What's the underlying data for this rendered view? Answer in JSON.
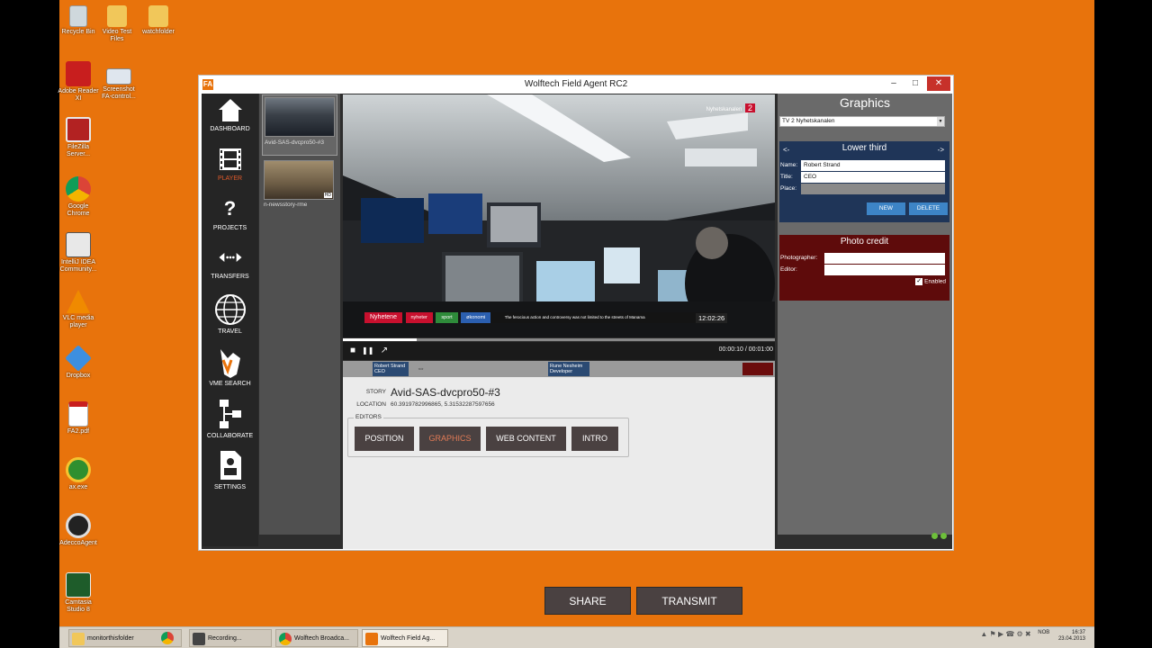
{
  "desktop": {
    "icons": [
      {
        "label": "Recycle Bin",
        "icon": "recycle-bin-icon"
      },
      {
        "label": "Video Test Files",
        "icon": "folder-icon"
      },
      {
        "label": "watchfolder",
        "icon": "folder-icon"
      },
      {
        "label": "Adobe Reader XI",
        "icon": "adobe-reader-icon"
      },
      {
        "label": "Screenshot FA-control...",
        "icon": "image-file-icon"
      },
      {
        "label": "FileZilla Server...",
        "icon": "filezilla-icon"
      },
      {
        "label": "Google Chrome",
        "icon": "chrome-icon"
      },
      {
        "label": "IntelliJ IDEA Community...",
        "icon": "intellij-icon"
      },
      {
        "label": "VLC media player",
        "icon": "vlc-icon"
      },
      {
        "label": "Dropbox",
        "icon": "dropbox-icon"
      },
      {
        "label": "FA2.pdf",
        "icon": "pdf-icon"
      },
      {
        "label": "ax.exe",
        "icon": "exe-icon"
      },
      {
        "label": "AdeccoAgent",
        "icon": "agent-icon"
      },
      {
        "label": "Camtasia Studio 8",
        "icon": "camtasia-icon"
      }
    ]
  },
  "window": {
    "title": "Wolftech Field Agent RC2",
    "logo": "FA",
    "minimize": "–",
    "maximize": "□",
    "close": "✕"
  },
  "nav": {
    "items": [
      {
        "label": "DASHBOARD",
        "icon": "home-icon"
      },
      {
        "label": "PLAYER",
        "icon": "film-icon"
      },
      {
        "label": "PROJECTS",
        "icon": "question-icon"
      },
      {
        "label": "TRANSFERS",
        "icon": "transfer-arrows-icon"
      },
      {
        "label": "TRAVEL",
        "icon": "globe-icon"
      },
      {
        "label": "VME SEARCH",
        "icon": "vme-logo-icon"
      },
      {
        "label": "COLLABORATE",
        "icon": "hierarchy-icon"
      },
      {
        "label": "SETTINGS",
        "icon": "settings-doc-icon"
      }
    ],
    "active": "PLAYER"
  },
  "thumbs": [
    {
      "label": "Avid-SAS-dvcpro50-#3",
      "selected": true
    },
    {
      "label": "n-newsstory-rme",
      "selected": false,
      "badge": "HD"
    }
  ],
  "video": {
    "channel_logo_text": "Nyhetskanalen",
    "channel_logo_num": "2",
    "ticker_brand": "Nyhetene",
    "ticker_tabs": [
      "nyheter",
      "sport",
      "økonomi"
    ],
    "ticker_text": "The ferocious action and controversy was not limited to the streets of Manama",
    "clock": "12:02:26",
    "progress_fraction": 0.17
  },
  "controls": {
    "stop": "■",
    "pause": "❚❚",
    "popout": "↗",
    "time": "00:00:10 / 00:01:00"
  },
  "timeline": [
    {
      "line1": "Robert Strand",
      "line2": "CEO"
    },
    {
      "line1": "Rune Nesheim",
      "line2": "Developer"
    }
  ],
  "info": {
    "story_label": "STORY",
    "story_value": "Avid-SAS-dvcpro50-#3",
    "location_label": "LOCATION",
    "location_value": "60.3919782996865, 5.31532287597656",
    "editors_legend": "EDITORS",
    "editor_buttons": [
      "POSITION",
      "GRAPHICS",
      "WEB CONTENT",
      "INTRO"
    ],
    "active_editor": "GRAPHICS",
    "share_label": "SHARE",
    "transmit_label": "TRANSMIT"
  },
  "graphics": {
    "header": "Graphics",
    "channel": "TV 2 Nyhetskanalen",
    "lower_third": {
      "title": "Lower third",
      "prev": "<-",
      "next": "->",
      "name_label": "Name:",
      "name_value": "Robert Strand",
      "title_label": "Title:",
      "title_value": "CEO",
      "place_label": "Place:",
      "place_value": "",
      "new_label": "NEW",
      "delete_label": "DELETE"
    },
    "photo_credit": {
      "title": "Photo credit",
      "photographer_label": "Photographer:",
      "editor_label": "Editor:",
      "enabled_label": "Enabled",
      "enabled": true
    }
  },
  "taskbar": {
    "items": [
      {
        "label": "monitorthisfolder",
        "icon": "folder-icon"
      },
      {
        "label": "",
        "icon": "chrome-icon"
      },
      {
        "label": "Recording...",
        "icon": "camtasia-icon"
      },
      {
        "label": "Wolftech Broadca...",
        "icon": "chrome-icon"
      },
      {
        "label": "Wolftech Field Ag...",
        "icon": "fieldagent-icon"
      }
    ],
    "lang": "NOB",
    "time": "16:37",
    "date": "23.04.2013"
  },
  "colors": {
    "desktop": "#e8730c",
    "active_nav": "#e05a2a",
    "lower_third_bg": "#1f3558",
    "photo_credit_bg": "#5e0b0b",
    "button_blue": "#3d84c6"
  }
}
